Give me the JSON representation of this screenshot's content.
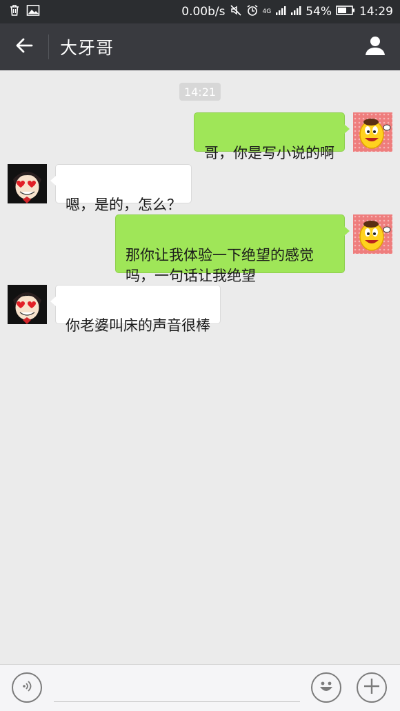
{
  "status_bar": {
    "net_speed": "0.00b/s",
    "network": "4G",
    "battery": "54%",
    "time": "14:29"
  },
  "header": {
    "title": "大牙哥"
  },
  "chat": {
    "timestamp": "14:21",
    "messages": [
      {
        "sender": "me",
        "text": "哥，你是写小说的啊"
      },
      {
        "sender": "other",
        "text": "嗯，是的，怎么？"
      },
      {
        "sender": "me",
        "text": "那你让我体验一下绝望的感觉\n吗，一句话让我绝望"
      },
      {
        "sender": "other",
        "text": "你老婆叫床的声音很棒"
      }
    ]
  },
  "colors": {
    "my_bubble": "#9fe658",
    "their_bubble": "#ffffff",
    "titlebar": "#393a3f"
  }
}
